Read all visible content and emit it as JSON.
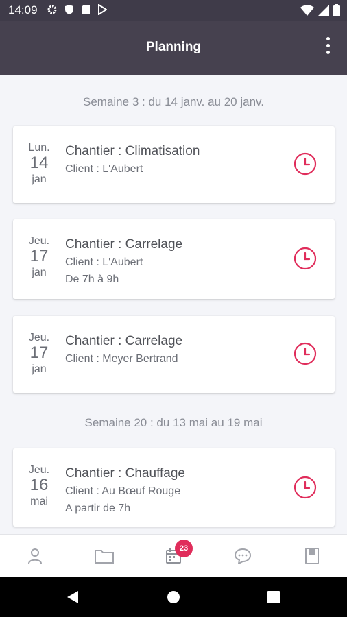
{
  "status_bar": {
    "time": "14:09"
  },
  "app_bar": {
    "title": "Planning"
  },
  "weeks": [
    {
      "label": "Semaine 3 : du 14 janv. au 20 janv."
    },
    {
      "label": "Semaine 20 : du 13 mai au 19 mai"
    }
  ],
  "cards": [
    {
      "weekday": "Lun.",
      "day": "14",
      "month": "jan",
      "title": "Chantier : Climatisation",
      "client": "Client :  L'Aubert",
      "time": ""
    },
    {
      "weekday": "Jeu.",
      "day": "17",
      "month": "jan",
      "title": "Chantier : Carrelage",
      "client": "Client :  L'Aubert",
      "time": "De 7h à 9h"
    },
    {
      "weekday": "Jeu.",
      "day": "17",
      "month": "jan",
      "title": "Chantier : Carrelage",
      "client": "Client : Meyer Bertrand",
      "time": ""
    },
    {
      "weekday": "Jeu.",
      "day": "16",
      "month": "mai",
      "title": "Chantier : Chauffage",
      "client": "Client : Au Bœuf Rouge",
      "time": "A partir de 7h"
    }
  ],
  "bottom_nav": {
    "items": [
      {
        "icon": "person-icon"
      },
      {
        "icon": "folder-icon"
      },
      {
        "icon": "calendar-icon",
        "badge": "23"
      },
      {
        "icon": "chat-icon"
      },
      {
        "icon": "book-icon"
      }
    ]
  },
  "colors": {
    "accent": "#e02d5b",
    "appbar": "#46414f",
    "statusbar": "#3f3b49"
  }
}
